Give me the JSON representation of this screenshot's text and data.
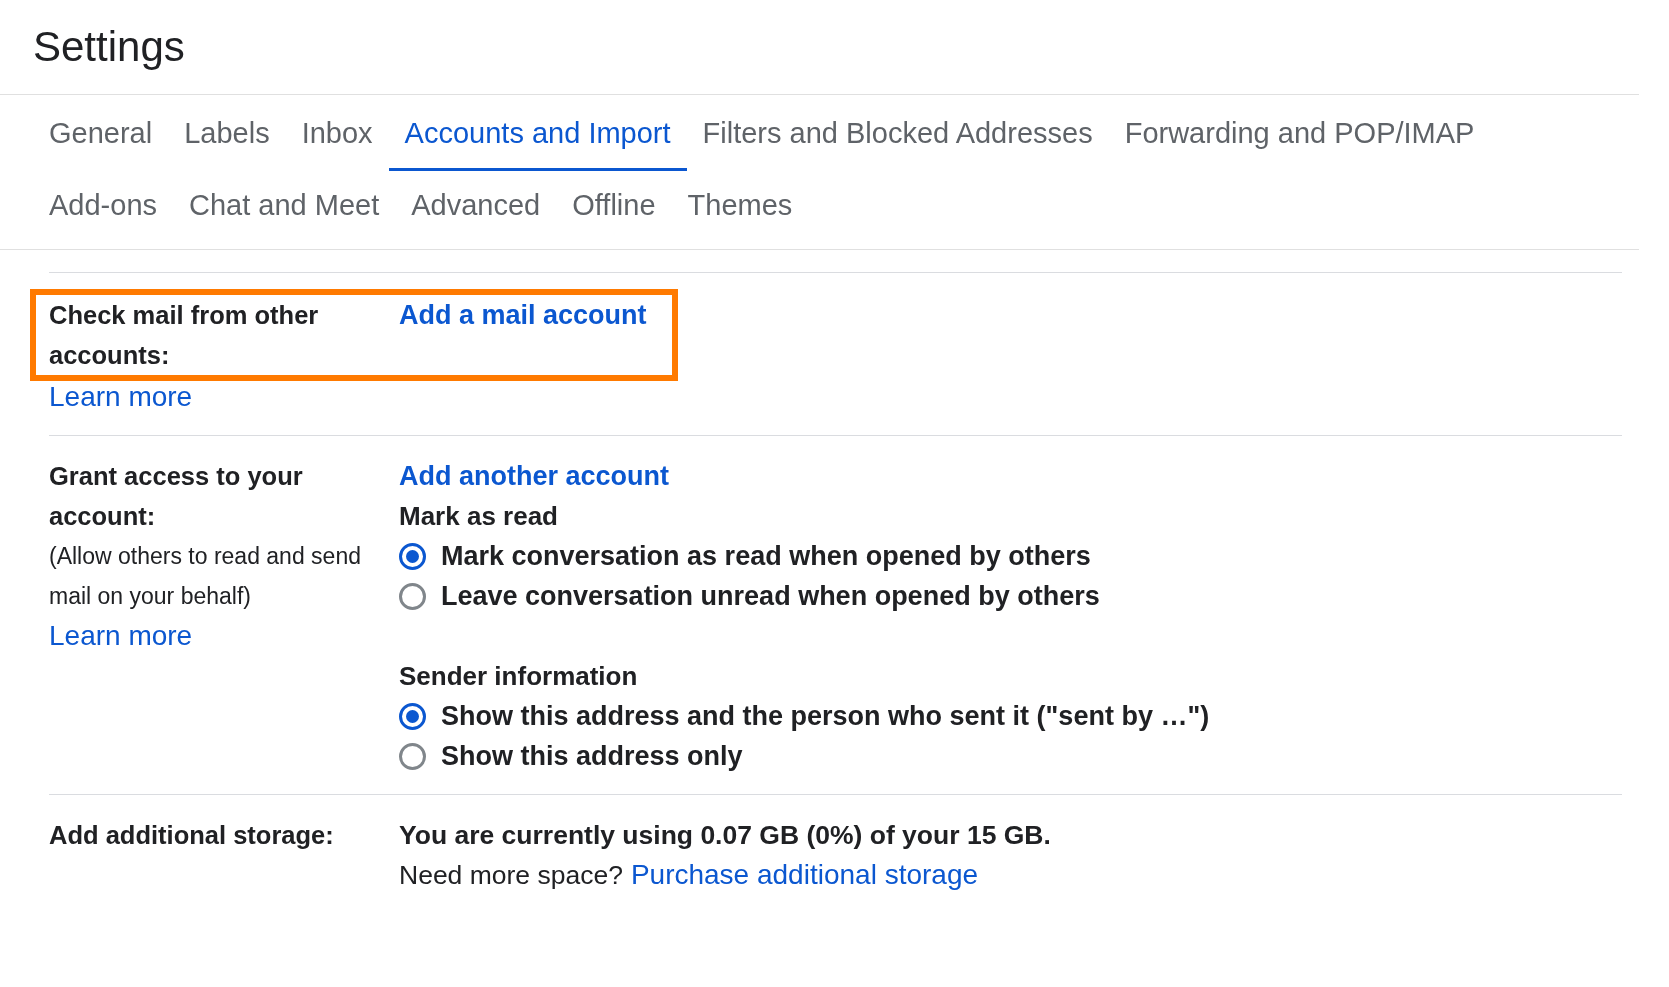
{
  "title": "Settings",
  "tab_rows": [
    [
      {
        "label": "General",
        "selected": false
      },
      {
        "label": "Labels",
        "selected": false
      },
      {
        "label": "Inbox",
        "selected": false
      },
      {
        "label": "Accounts and Import",
        "selected": true
      },
      {
        "label": "Filters and Blocked Addresses",
        "selected": false
      },
      {
        "label": "Forwarding and POP/IMAP",
        "selected": false
      }
    ],
    [
      {
        "label": "Add-ons",
        "selected": false
      },
      {
        "label": "Chat and Meet",
        "selected": false
      },
      {
        "label": "Advanced",
        "selected": false
      },
      {
        "label": "Offline",
        "selected": false
      },
      {
        "label": "Themes",
        "selected": false
      }
    ]
  ],
  "sections": [
    {
      "label": "Check mail from other accounts:",
      "highlighted": true,
      "learn_more": "Learn more",
      "action_link": "Add a mail account"
    },
    {
      "label": "Grant access to your account:",
      "note": "(Allow others to read and send mail on your behalf)",
      "learn_more": "Learn more",
      "action_link": "Add another account",
      "groups": [
        {
          "heading": "Mark as read",
          "options": [
            {
              "label": "Mark conversation as read when opened by others",
              "selected": true
            },
            {
              "label": "Leave conversation unread when opened by others",
              "selected": false
            }
          ]
        },
        {
          "heading": "Sender information",
          "options": [
            {
              "label": "Show this address and the person who sent it (\"sent by …\")",
              "selected": true
            },
            {
              "label": "Show this address only",
              "selected": false
            }
          ]
        }
      ]
    },
    {
      "label": "Add additional storage:",
      "usage": "You are currently using 0.07 GB (0%) of your 15 GB.",
      "prompt": "Need more space?",
      "purchase_link": "Purchase additional storage"
    }
  ]
}
